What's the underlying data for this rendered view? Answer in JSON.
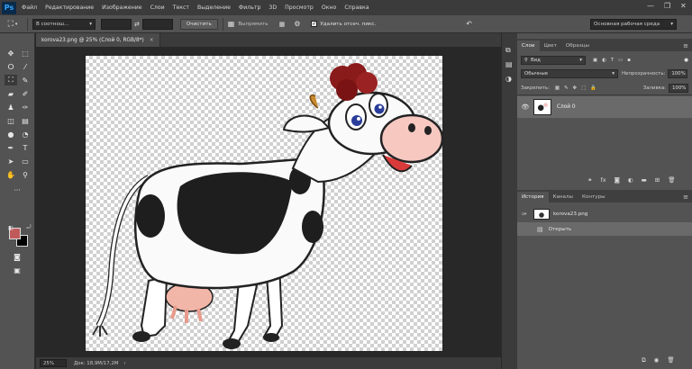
{
  "app": {
    "logo": "Ps"
  },
  "menu": [
    "Файл",
    "Редактирование",
    "Изображение",
    "Слои",
    "Текст",
    "Выделение",
    "Фильтр",
    "3D",
    "Просмотр",
    "Окно",
    "Справка"
  ],
  "window_controls": {
    "minimize": "—",
    "maximize": "❐",
    "close": "✕"
  },
  "options": {
    "ratio_select": "В соотнош...",
    "clear_button": "Очистить",
    "straighten_label": "Выпрямить",
    "delete_cropped_label": "Удалить отсеч. пикс.",
    "delete_cropped_checked": true,
    "workspace_select": "Основная рабочая среда"
  },
  "document": {
    "tab_title": "korova23.png @ 25% (Слой 0, RGB/8*)",
    "tab_close": "×",
    "zoom": "25%",
    "doc_info": "Док: 18,9M/17,2M"
  },
  "layers_panel": {
    "tabs": [
      "Слои",
      "Цвет",
      "Образцы"
    ],
    "filter_select": "Вид",
    "blend_mode": "Обычные",
    "opacity_label": "Непрозрачность:",
    "opacity_value": "100%",
    "lock_label": "Закрепить:",
    "fill_label": "Заливка:",
    "fill_value": "100%",
    "layers": [
      {
        "name": "Слой 0"
      }
    ]
  },
  "history_panel": {
    "tabs": [
      "История",
      "Каналы",
      "Контуры"
    ],
    "snapshot_name": "korova23.png",
    "steps": [
      "Открыть"
    ]
  },
  "colors": {
    "foreground": "#c0595a",
    "background": "#000000",
    "accent": "#31a8ff"
  }
}
